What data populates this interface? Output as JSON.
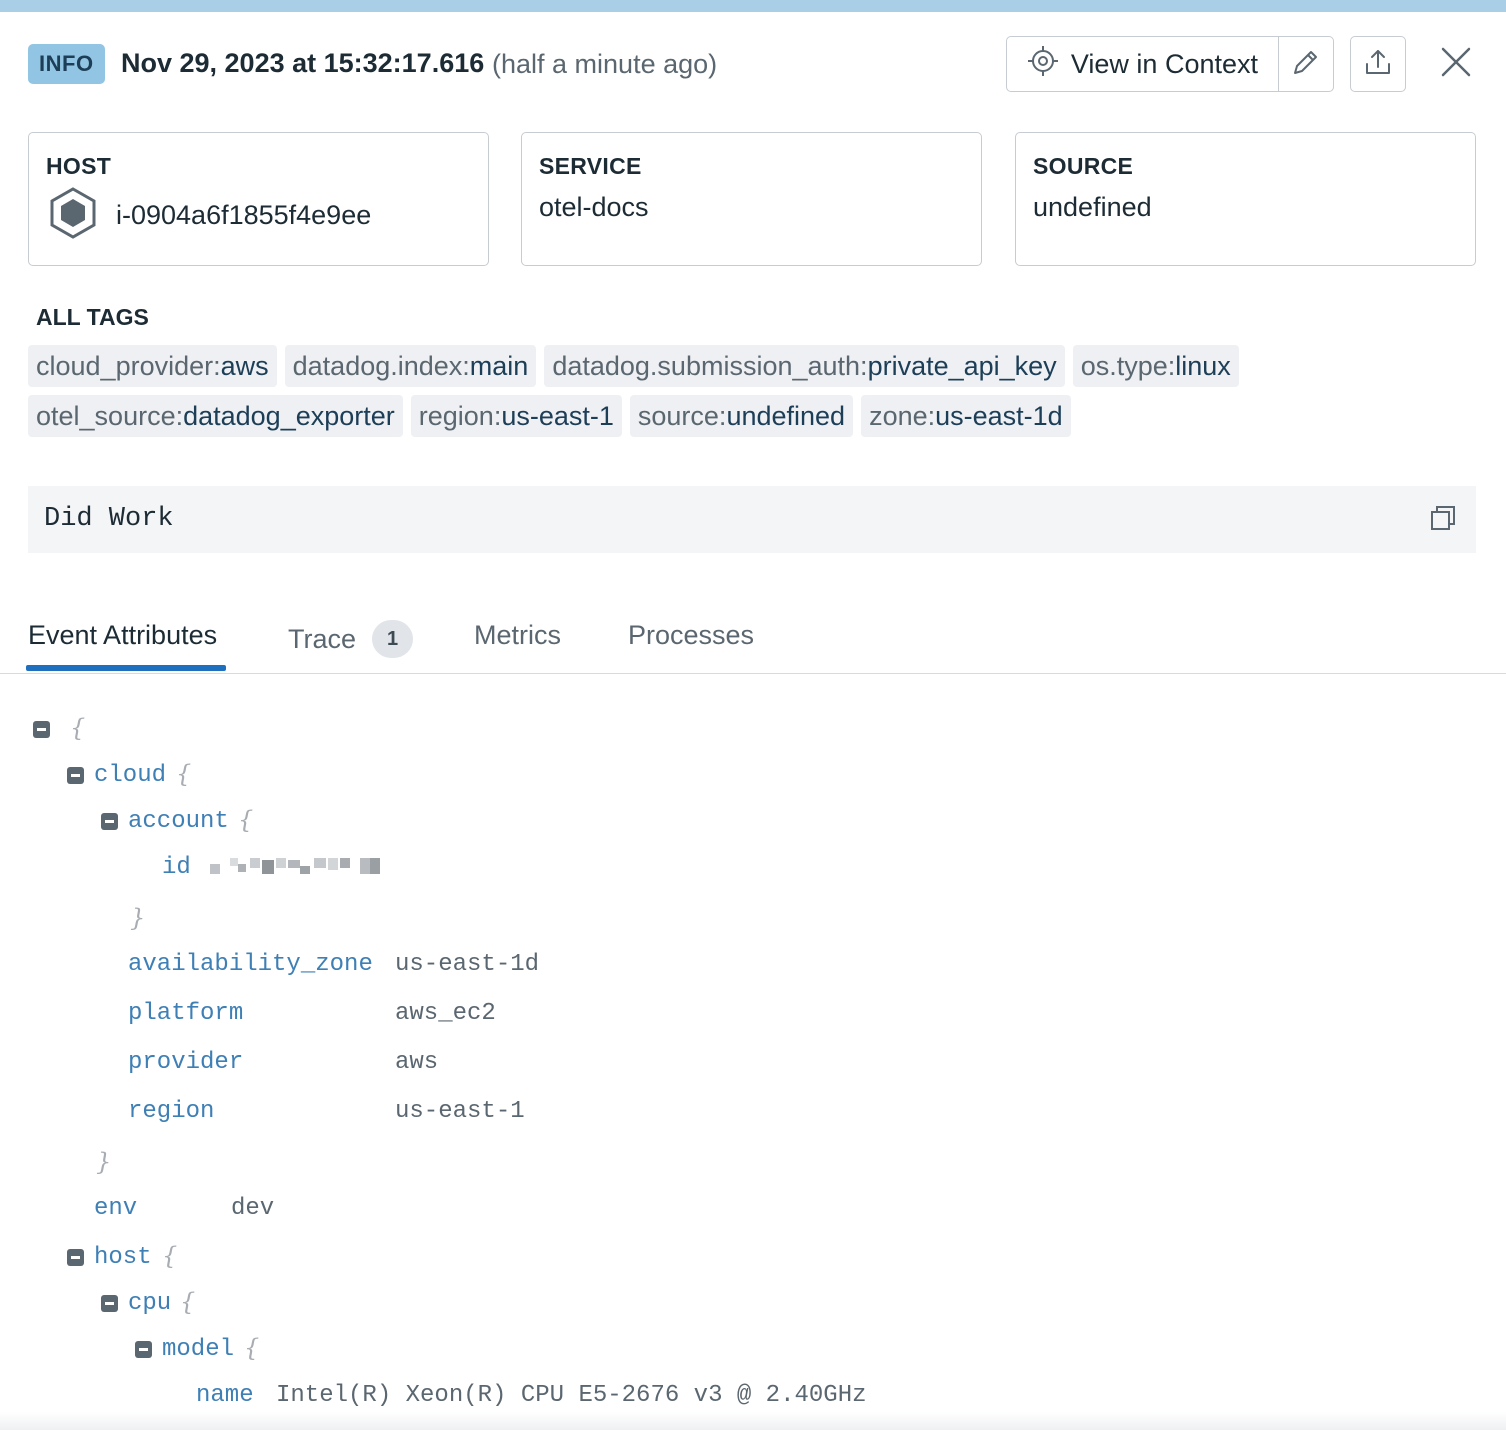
{
  "header": {
    "level_badge": "INFO",
    "timestamp": "Nov 29, 2023 at 15:32:17.616",
    "relative_time": "(half a minute ago)",
    "view_in_context_label": "View in Context"
  },
  "cards": {
    "host": {
      "label": "HOST",
      "value": "i-0904a6f1855f4e9ee"
    },
    "service": {
      "label": "SERVICE",
      "value": "otel-docs"
    },
    "source": {
      "label": "SOURCE",
      "value": "undefined"
    }
  },
  "tags": {
    "title": "ALL TAGS",
    "row1": [
      {
        "key": "cloud_provider:",
        "value": "aws"
      },
      {
        "key": "datadog.index:",
        "value": "main"
      },
      {
        "key": "datadog.submission_auth:",
        "value": "private_api_key"
      },
      {
        "key": "os.type:",
        "value": "linux"
      }
    ],
    "row2": [
      {
        "key": "otel_source:",
        "value": "datadog_exporter"
      },
      {
        "key": "region:",
        "value": "us-east-1"
      },
      {
        "key": "source:",
        "value": "undefined"
      },
      {
        "key": "zone:",
        "value": "us-east-1d"
      }
    ]
  },
  "message": {
    "text": "Did Work"
  },
  "tabs": {
    "event_attributes": "Event Attributes",
    "trace": "Trace",
    "trace_count": "1",
    "metrics": "Metrics",
    "processes": "Processes"
  },
  "attributes": {
    "open_brace": "{",
    "close_brace": "}",
    "cloud_key": "cloud",
    "account_key": "account",
    "id_key": "id",
    "availability_zone_key": "availability_zone",
    "availability_zone_value": "us-east-1d",
    "platform_key": "platform",
    "platform_value": "aws_ec2",
    "provider_key": "provider",
    "provider_value": "aws",
    "region_key": "region",
    "region_value": "us-east-1",
    "env_key": "env",
    "env_value": "dev",
    "host_key": "host",
    "cpu_key": "cpu",
    "model_key": "model",
    "name_key": "name",
    "name_value": "Intel(R) Xeon(R) CPU E5-2676 v3 @ 2.40GHz"
  },
  "colors": {
    "accent": "#1f6fbf",
    "info_badge": "#92c5e3",
    "json_key": "#3e7fb5",
    "tag_bg": "#eef0f3"
  },
  "icons": [
    "target-icon",
    "pencil-icon",
    "upload-icon",
    "close-icon",
    "hexagon-host-icon",
    "copy-icon",
    "collapse-icon"
  ]
}
